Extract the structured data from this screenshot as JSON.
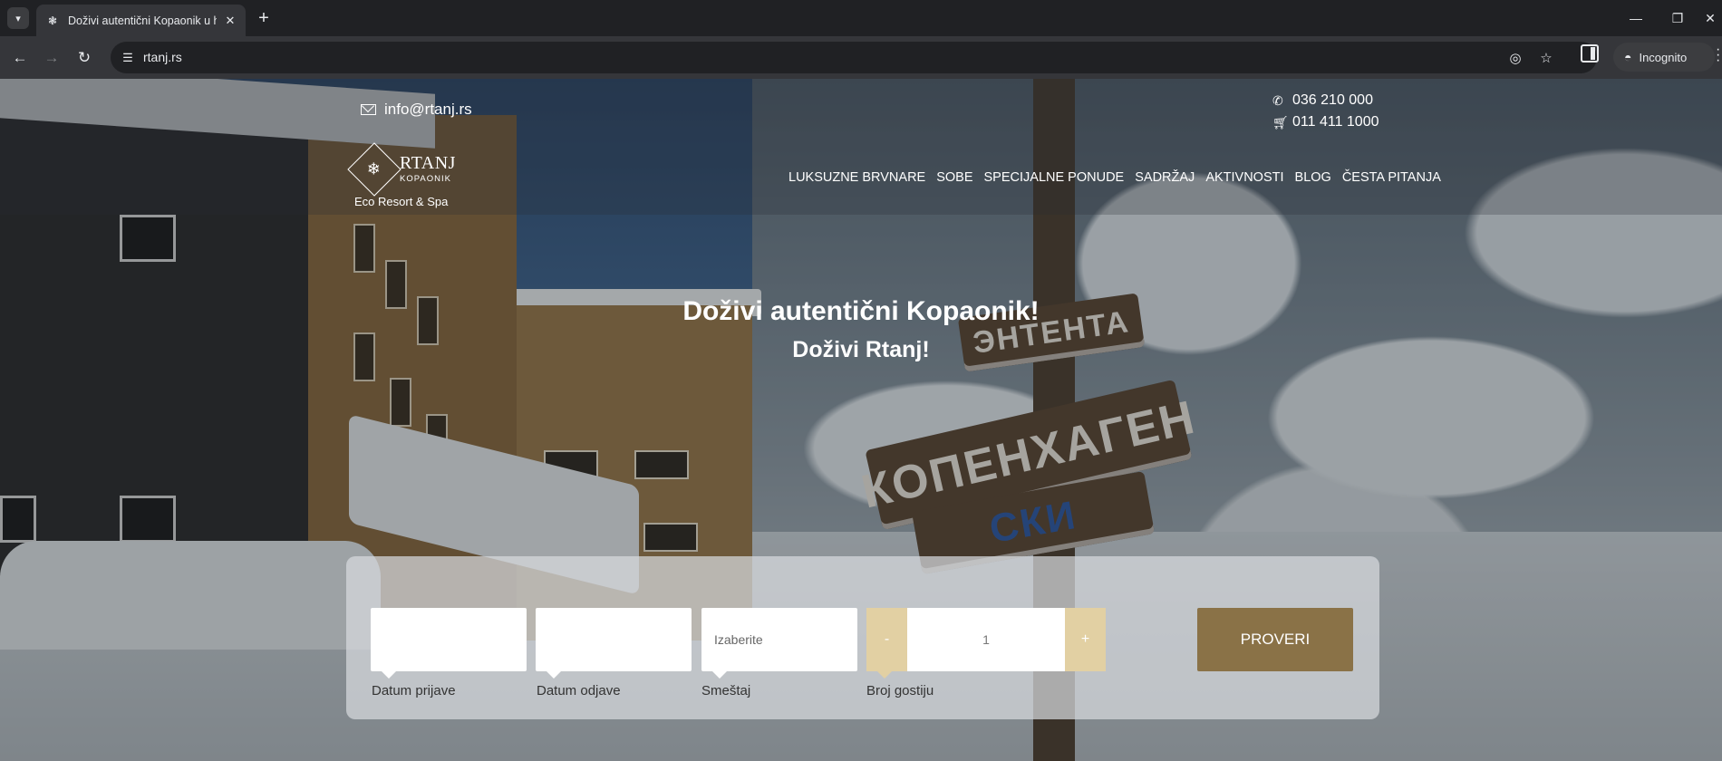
{
  "browser": {
    "tab_title": "Doživi autentični Kopaonik u ho",
    "url": "rtanj.rs",
    "incognito_label": "Incognito"
  },
  "site": {
    "email": "info@rtanj.rs",
    "phone_1": "036 210 000",
    "phone_2": "011 411 1000",
    "logo": {
      "name": "RTANJ",
      "sub": "KOPAONIK",
      "tagline": "Eco Resort & Spa"
    },
    "nav": [
      "LUKSUZNE BRVNARE",
      "SOBE",
      "SPECIJALNE PONUDE",
      "SADRŽAJ",
      "AKTIVNOSTI",
      "BLOG",
      "ČESTA PITANJA"
    ]
  },
  "hero": {
    "title": "Doživi autentični Kopaonik!",
    "subtitle": "Doživi Rtanj!"
  },
  "background_signs": [
    "ЭНТЕНТА",
    "КОПЕНХАГЕН",
    "СКИ"
  ],
  "booking": {
    "checkin_label": "Datum prijave",
    "checkin_value": "",
    "checkout_label": "Datum odjave",
    "checkout_value": "",
    "accommodation_label": "Smeštaj",
    "accommodation_placeholder": "Izaberite",
    "guests_label": "Broj gostiju",
    "guests_value": "1",
    "decrement": "-",
    "increment": "+",
    "submit_label": "PROVERI"
  },
  "colors": {
    "accent": "#8a7247",
    "stepper": "#e2d0a3",
    "chrome_bg": "#202124",
    "toolbar_bg": "#35363a"
  },
  "icons": [
    "tab-search-icon",
    "rtanj-favicon",
    "close-icon",
    "plus-icon",
    "minimize-icon",
    "restore-icon",
    "window-close-icon",
    "back-arrow-icon",
    "forward-arrow-icon",
    "reload-icon",
    "site-info-icon",
    "eye-off-icon",
    "star-icon",
    "side-panel-icon",
    "incognito-icon",
    "menu-kebab-icon",
    "envelope-icon",
    "phone-icon",
    "cart-icon",
    "snowflake-emblem-icon"
  ]
}
